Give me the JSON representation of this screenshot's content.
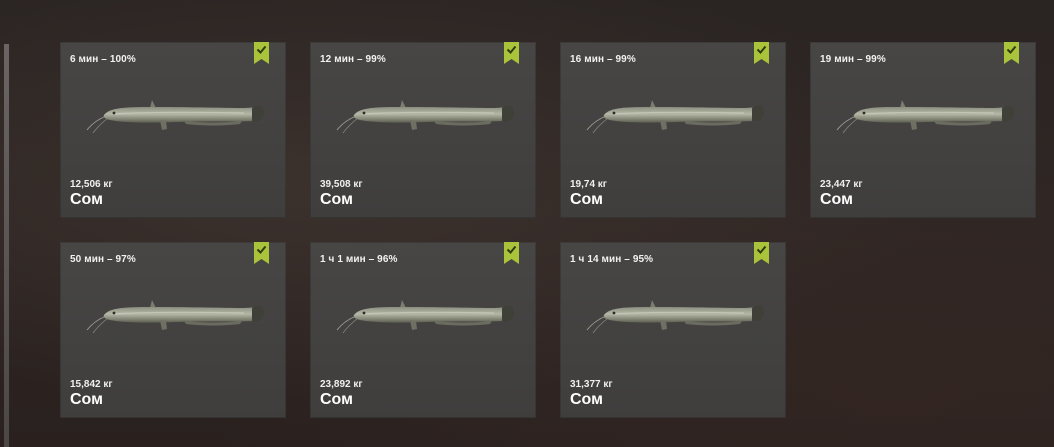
{
  "colors": {
    "badge": "#a9c43a",
    "card_bg": "#444342",
    "text": "#f2f2f0"
  },
  "icons": {
    "badge": "check-bookmark-icon",
    "fish": "catfish-icon"
  },
  "catches": [
    {
      "time": "6 мин – 100%",
      "weight": "12,506 кг",
      "name": "Сом",
      "checked": true
    },
    {
      "time": "12 мин – 99%",
      "weight": "39,508 кг",
      "name": "Сом",
      "checked": true
    },
    {
      "time": "16 мин – 99%",
      "weight": "19,74 кг",
      "name": "Сом",
      "checked": true
    },
    {
      "time": "19 мин – 99%",
      "weight": "23,447 кг",
      "name": "Сом",
      "checked": true
    },
    {
      "time": "50 мин – 97%",
      "weight": "15,842 кг",
      "name": "Сом",
      "checked": true
    },
    {
      "time": "1 ч 1 мин – 96%",
      "weight": "23,892 кг",
      "name": "Сом",
      "checked": true
    },
    {
      "time": "1 ч 14 мин – 95%",
      "weight": "31,377 кг",
      "name": "Сом",
      "checked": true
    }
  ]
}
